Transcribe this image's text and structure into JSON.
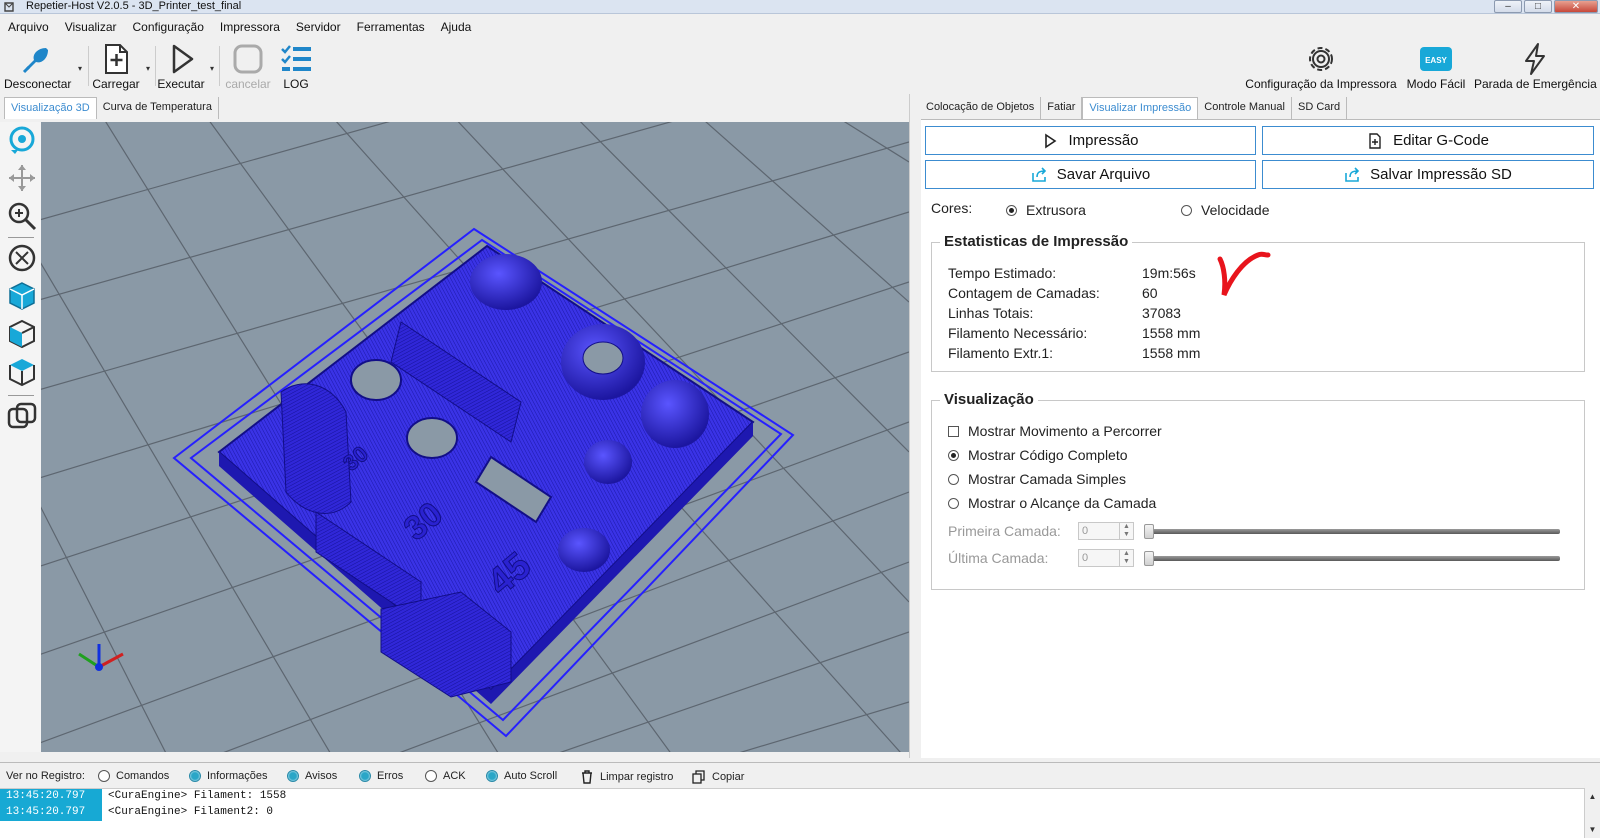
{
  "window": {
    "title": "Repetier-Host V2.0.5 - 3D_Printer_test_final",
    "controls": {
      "minimize": "–",
      "maximize": "□",
      "close": "✕"
    }
  },
  "menu": [
    "Arquivo",
    "Visualizar",
    "Configuração",
    "Impressora",
    "Servidor",
    "Ferramentas",
    "Ajuda"
  ],
  "toolbar": {
    "disconnect": "Desconectar",
    "load": "Carregar",
    "execute": "Executar",
    "cancel": "cancelar",
    "log": "LOG",
    "printer_config": "Configuração da Impressora",
    "easy_mode": "Modo Fácil",
    "easy_badge": "EASY",
    "emergency": "Parada de Emergência"
  },
  "left_tabs": [
    "Visualização 3D",
    "Curva de Temperatura"
  ],
  "right_tabs": [
    "Colocação de Objetos",
    "Fatiar",
    "Visualizar Impressão",
    "Controle Manual",
    "SD Card"
  ],
  "viewport": {
    "model_labels": [
      "30",
      "45",
      "30"
    ]
  },
  "preview": {
    "buttons": {
      "print": "Impressão",
      "edit_gcode": "Editar G-Code",
      "save_file": "Savar Arquivo",
      "save_sd": "Salvar Impressão SD"
    },
    "colors_label": "Cores:",
    "color_options": [
      "Extrusora",
      "Velocidade"
    ],
    "color_selected": "Extrusora",
    "stats": {
      "title": "Estatisticas de Impressão",
      "rows": [
        {
          "label": "Tempo Estimado:",
          "value": "19m:56s"
        },
        {
          "label": "Contagem de Camadas:",
          "value": "60"
        },
        {
          "label": "Linhas Totais:",
          "value": "37083"
        },
        {
          "label": "Filamento Necessário:",
          "value": "1558 mm"
        },
        {
          "label": "Filamento Extr.1:",
          "value": "1558 mm"
        }
      ]
    },
    "visualization": {
      "title": "Visualização",
      "show_travel": "Mostrar Movimento a Percorrer",
      "options": [
        "Mostrar Código Completo",
        "Mostrar Camada Simples",
        "Mostrar o Alcançe da Camada"
      ],
      "selected_option": "Mostrar Código Completo",
      "first_layer_label": "Primeira Camada:",
      "first_layer_value": "0",
      "last_layer_label": "Última Camada:",
      "last_layer_value": "0"
    }
  },
  "log": {
    "label": "Ver no Registro:",
    "filters": [
      {
        "label": "Comandos",
        "on": false
      },
      {
        "label": "Informações",
        "on": true
      },
      {
        "label": "Avisos",
        "on": true
      },
      {
        "label": "Erros",
        "on": true
      },
      {
        "label": "ACK",
        "on": false
      },
      {
        "label": "Auto Scroll",
        "on": true
      }
    ],
    "clear": "Limpar registro",
    "copy": "Copiar",
    "lines": [
      {
        "time": "13:45:20.797",
        "msg": "<CuraEngine> Filament: 1558"
      },
      {
        "time": "13:45:20.797",
        "msg": "<CuraEngine> Filament2: 0"
      }
    ]
  },
  "colors": {
    "accent": "#3c8cd0",
    "model": "#3a33e6",
    "viewport_bg": "#8a99a6",
    "log_time_bg": "#17a9d4",
    "annotation": "#e8141c"
  }
}
